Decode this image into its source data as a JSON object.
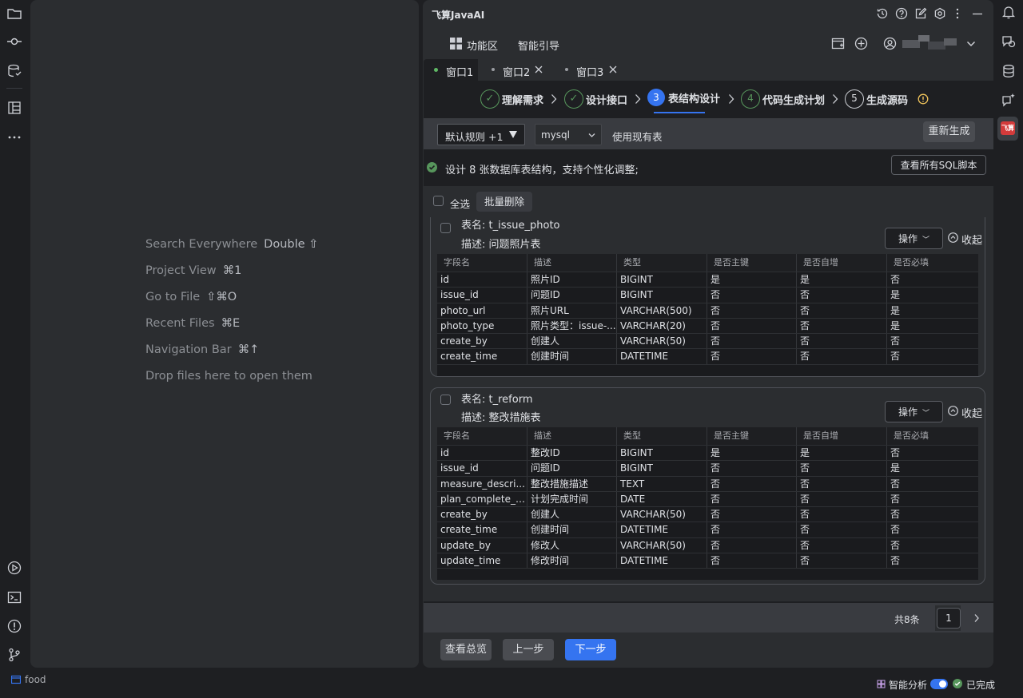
{
  "editor": {
    "hints": [
      {
        "label": "Search Everywhere",
        "keys": "Double ⇧"
      },
      {
        "label": "Project View",
        "keys": "⌘1"
      },
      {
        "label": "Go to File",
        "keys": "⇧⌘O"
      },
      {
        "label": "Recent Files",
        "keys": "⌘E"
      },
      {
        "label": "Navigation Bar",
        "keys": "⌘↑"
      },
      {
        "label": "Drop files here to open them",
        "keys": ""
      }
    ]
  },
  "status_bar": {
    "project": "food",
    "analysis_label": "智能分析",
    "done_label": "已完成"
  },
  "plugin": {
    "title": "飞算JavaAI",
    "nav": {
      "func_label": "功能区",
      "guide_label": "智能引导"
    },
    "windows": [
      "窗口1",
      "窗口2",
      "窗口3"
    ],
    "steps": [
      {
        "num": "✓",
        "label": "理解需求",
        "state": "done"
      },
      {
        "num": "✓",
        "label": "设计接口",
        "state": "done"
      },
      {
        "num": "3",
        "label": "表结构设计",
        "state": "active"
      },
      {
        "num": "4",
        "label": "代码生成计划",
        "state": "pending"
      },
      {
        "num": "5",
        "label": "生成源码",
        "state": "pending"
      }
    ],
    "toolbar": {
      "rule_select": "默认规则 +1",
      "db_select": "mysql",
      "use_existing": "使用现有表",
      "regenerate": "重新生成"
    },
    "info": {
      "text": "设计 8 张数据库表结构，支持个性化调整;",
      "view_sql": "查看所有SQL脚本"
    },
    "select_all": "全选",
    "batch_delete": "批量删除",
    "columns": [
      "字段名",
      "描述",
      "类型",
      "是否主键",
      "是否自增",
      "是否必填"
    ],
    "tables": [
      {
        "name_line": "表名: t_issue_photo",
        "desc_line": "描述: 问题照片表",
        "op_label": "操作",
        "collapse_label": "收起",
        "rows": [
          [
            "id",
            "照片ID",
            "BIGINT",
            "是",
            "是",
            "否"
          ],
          [
            "issue_id",
            "问题ID",
            "BIGINT",
            "否",
            "否",
            "是"
          ],
          [
            "photo_url",
            "照片URL",
            "VARCHAR(500)",
            "否",
            "否",
            "是"
          ],
          [
            "photo_type",
            "照片类型：issue-...",
            "VARCHAR(20)",
            "否",
            "否",
            "是"
          ],
          [
            "create_by",
            "创建人",
            "VARCHAR(50)",
            "否",
            "否",
            "否"
          ],
          [
            "create_time",
            "创建时间",
            "DATETIME",
            "否",
            "否",
            "否"
          ]
        ]
      },
      {
        "name_line": "表名: t_reform",
        "desc_line": "描述: 整改措施表",
        "op_label": "操作",
        "collapse_label": "收起",
        "rows": [
          [
            "id",
            "整改ID",
            "BIGINT",
            "是",
            "是",
            "否"
          ],
          [
            "issue_id",
            "问题ID",
            "BIGINT",
            "否",
            "否",
            "是"
          ],
          [
            "measure_descri...",
            "整改措施描述",
            "TEXT",
            "否",
            "否",
            "否"
          ],
          [
            "plan_complete_t...",
            "计划完成时间",
            "DATE",
            "否",
            "否",
            "否"
          ],
          [
            "create_by",
            "创建人",
            "VARCHAR(50)",
            "否",
            "否",
            "否"
          ],
          [
            "create_time",
            "创建时间",
            "DATETIME",
            "否",
            "否",
            "否"
          ],
          [
            "update_by",
            "修改人",
            "VARCHAR(50)",
            "否",
            "否",
            "否"
          ],
          [
            "update_time",
            "修改时间",
            "DATETIME",
            "否",
            "否",
            "否"
          ]
        ]
      }
    ],
    "pagination": {
      "total": "共8条",
      "page": "1"
    },
    "footer": {
      "overview": "查看总览",
      "prev": "上一步",
      "next": "下一步"
    }
  },
  "colors": {
    "accent": "#3574f0",
    "success": "#57965c",
    "warning": "#f2c55c"
  }
}
